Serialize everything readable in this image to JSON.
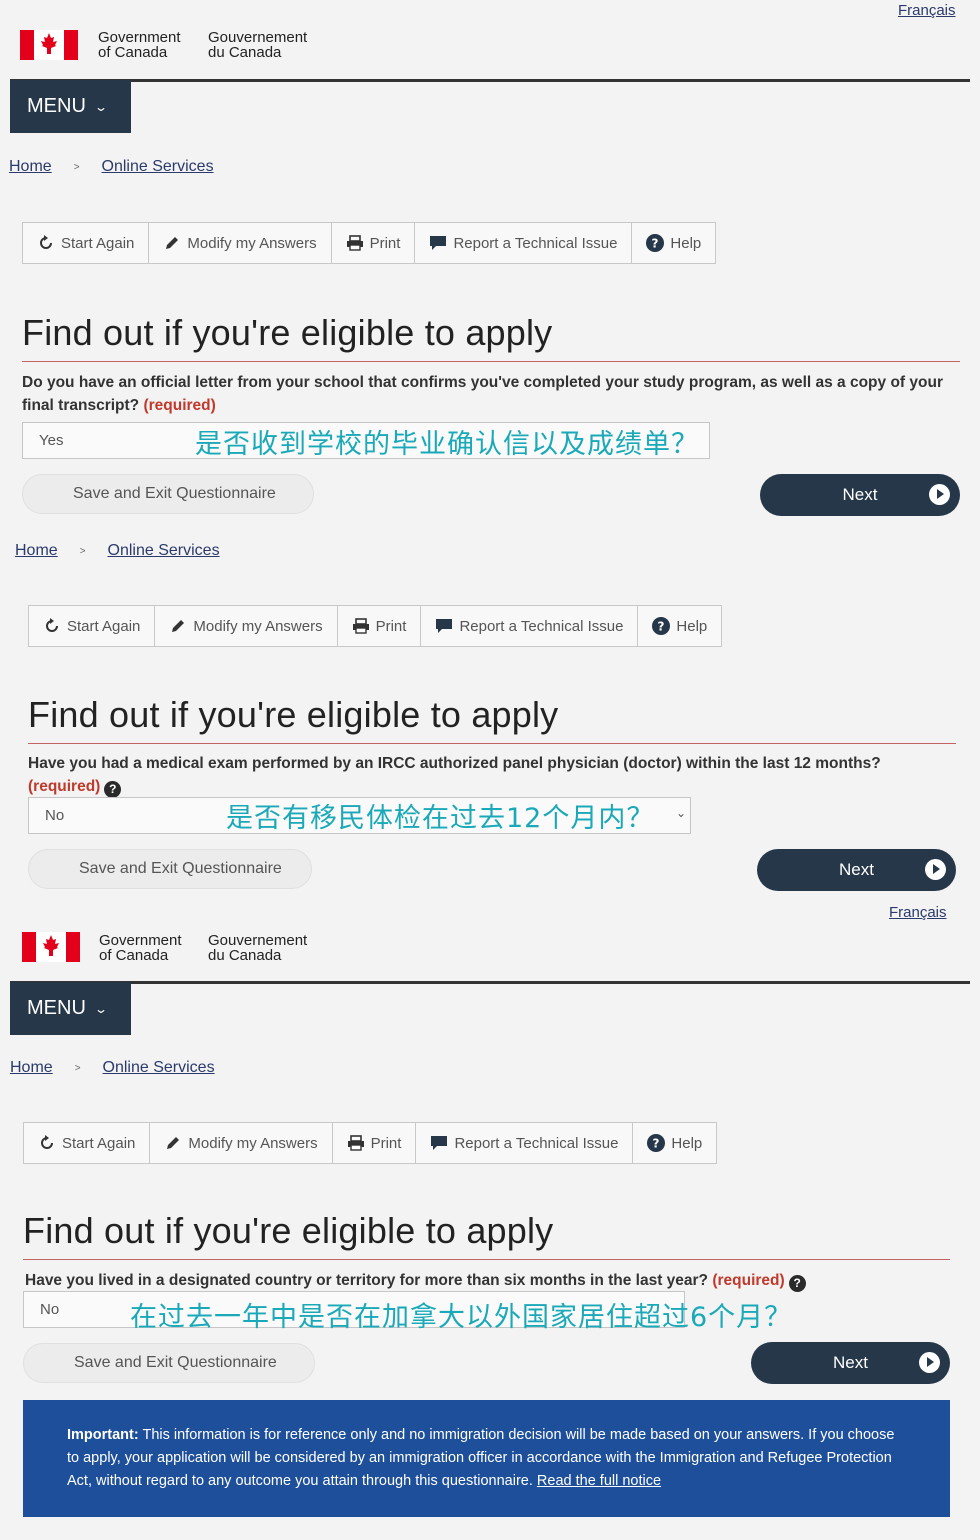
{
  "header": {
    "language_link": "Français",
    "gov_en_line1": "Government",
    "gov_en_line2": "of Canada",
    "gov_fr_line1": "Gouvernement",
    "gov_fr_line2": "du Canada",
    "menu_label": "MENU"
  },
  "breadcrumb": {
    "home": "Home",
    "online_services": "Online Services"
  },
  "toolbar": {
    "start_again": "Start Again",
    "modify_answers": "Modify my Answers",
    "print": "Print",
    "report_issue": "Report a Technical Issue",
    "help": "Help"
  },
  "page_title": "Find out if you're eligible to apply",
  "required_label": "(required)",
  "save_exit_label": "Save and Exit Questionnaire",
  "next_label": "Next",
  "sections": [
    {
      "question": "Do you have an official letter from your school that confirms you've completed your study program, as well as a copy of your final transcript?",
      "answer": "Yes",
      "annotation": "是否收到学校的毕业确认信以及成绩单？"
    },
    {
      "question": "Have you had a medical exam performed by an IRCC authorized panel physician (doctor) within the last 12 months?",
      "answer": "No",
      "annotation": "是否有移民体检在过去12个月内？"
    },
    {
      "question": "Have you lived in a designated country or territory for more than six months in the last year?",
      "answer": "No",
      "annotation": "在过去一年中是否在加拿大以外国家居住超过6个月？"
    }
  ],
  "notice": {
    "label": "Important:",
    "text": "This information is for reference only and no immigration decision will be made based on your answers. If you choose to apply, your application will be considered by an immigration officer in accordance with the Immigration and Refugee Protection Act, without regard to any outcome you attain through this questionnaire.",
    "link": "Read the full notice"
  },
  "colors": {
    "brand_navy": "#26374a",
    "required_red": "#c0392b",
    "annotation_teal": "#1aa9b8",
    "notice_blue": "#1e4f9a"
  },
  "icons": [
    "refresh-icon",
    "pencil-icon",
    "printer-icon",
    "comment-icon",
    "question-circle-icon",
    "play-circle-icon",
    "chevron-down-icon",
    "maple-leaf-icon"
  ]
}
